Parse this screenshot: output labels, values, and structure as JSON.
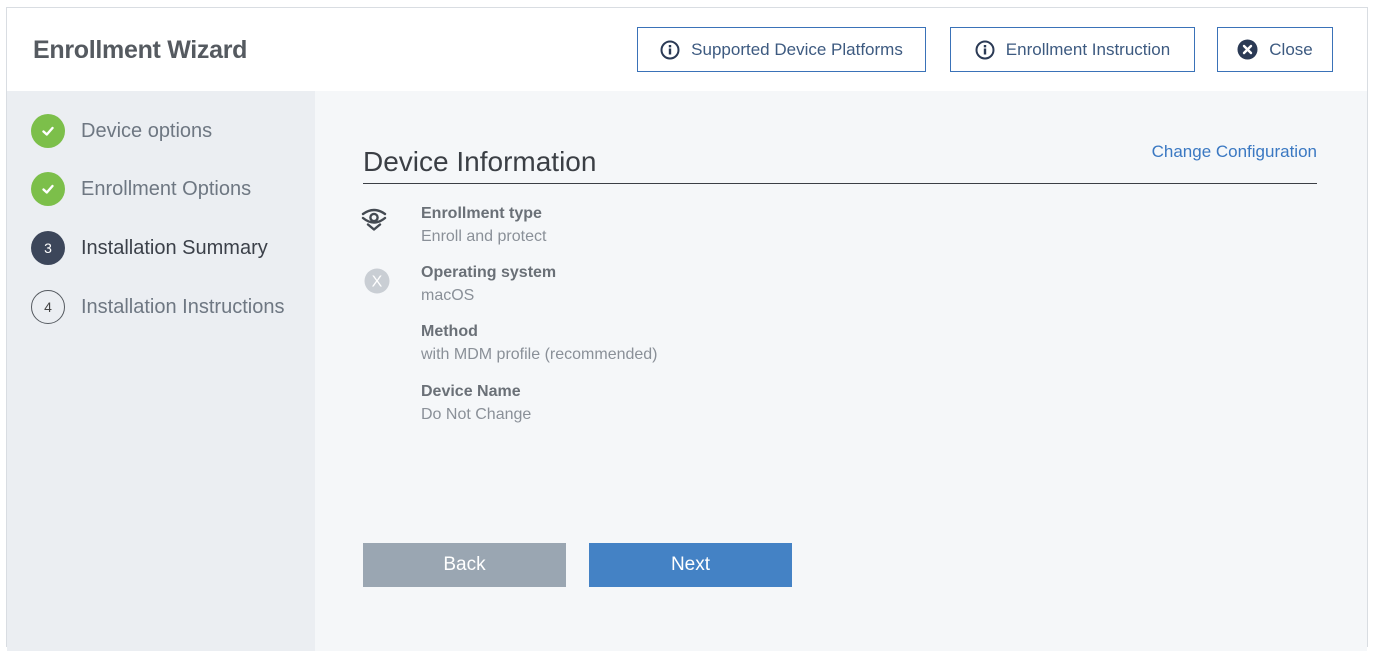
{
  "header": {
    "title": "Enrollment Wizard",
    "buttons": {
      "platforms": "Supported Device Platforms",
      "instruction": "Enrollment Instruction",
      "close": "Close"
    }
  },
  "steps": [
    {
      "label": "Device options",
      "status": "done",
      "number": ""
    },
    {
      "label": "Enrollment Options",
      "status": "done",
      "number": ""
    },
    {
      "label": "Installation Summary",
      "status": "current",
      "number": "3"
    },
    {
      "label": "Installation Instructions",
      "status": "future",
      "number": "4"
    }
  ],
  "main": {
    "section_title": "Device Information",
    "change_config": "Change Configuration",
    "items": [
      {
        "label": "Enrollment type",
        "value": "Enroll and protect",
        "icon": "eye-shield-icon"
      },
      {
        "label": "Operating system",
        "value": "macOS",
        "icon": "macos-x-icon"
      },
      {
        "label": "Method",
        "value": "with MDM profile (recommended)"
      },
      {
        "label": "Device Name",
        "value": "Do Not Change"
      }
    ],
    "back_label": "Back",
    "next_label": "Next"
  },
  "colors": {
    "accent": "#3a72b8",
    "step_done": "#7cbf4a",
    "step_current": "#3c465a",
    "next_button": "#4482c5",
    "back_button": "#9aa6b2"
  }
}
